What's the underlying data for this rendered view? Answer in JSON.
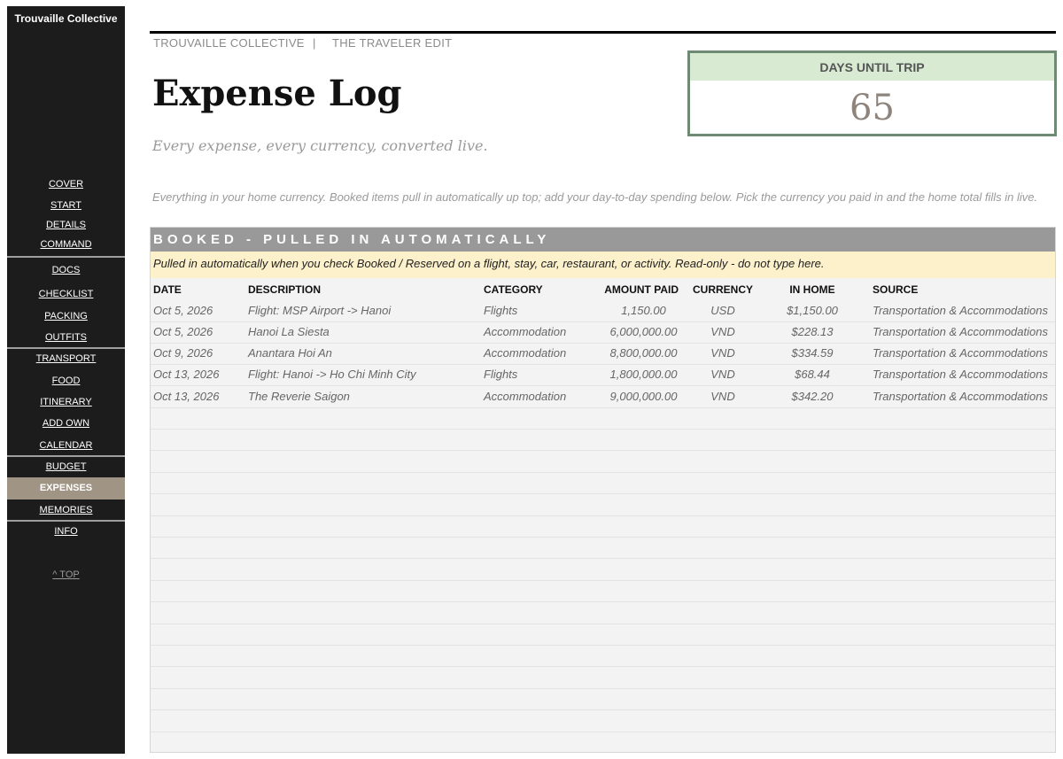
{
  "sidebar": {
    "brand": "Trouvaille Collective",
    "items": [
      {
        "label": "COVER"
      },
      {
        "label": "START"
      },
      {
        "label": "DETAILS"
      },
      {
        "label": "COMMAND"
      },
      {
        "label": "DOCS"
      },
      {
        "label": "CHECKLIST"
      },
      {
        "label": "PACKING"
      },
      {
        "label": "OUTFITS"
      },
      {
        "label": "TRANSPORT"
      },
      {
        "label": "FOOD"
      },
      {
        "label": "ITINERARY"
      },
      {
        "label": "ADD OWN"
      },
      {
        "label": "CALENDAR"
      },
      {
        "label": "BUDGET"
      },
      {
        "label": "EXPENSES"
      },
      {
        "label": "MEMORIES"
      },
      {
        "label": "INFO"
      }
    ],
    "active": "EXPENSES",
    "top_link": "^ TOP"
  },
  "header": {
    "brand": "TROUVAILLE COLLECTIVE",
    "separator": "|",
    "edition": "THE TRAVELER EDIT",
    "title": "Expense Log",
    "subtitle": "Every expense, every currency, converted live.",
    "intro": "Everything in your home currency. Booked items pull in automatically up top; add your day-to-day spending below. Pick the currency you paid in and the home total fills in live."
  },
  "countdown": {
    "label": "DAYS UNTIL TRIP",
    "value": "65"
  },
  "booked": {
    "title": "BOOKED  -  PULLED IN AUTOMATICALLY",
    "notice": "Pulled in automatically when you check Booked / Reserved on a flight, stay, car, restaurant, or activity. Read-only - do not type here.",
    "columns": {
      "date": "DATE",
      "description": "DESCRIPTION",
      "category": "CATEGORY",
      "amount": "AMOUNT PAID",
      "currency": "CURRENCY",
      "home": "IN HOME",
      "source": "SOURCE"
    },
    "rows": [
      {
        "date": "Oct 5, 2026",
        "description": "Flight: MSP Airport -> Hanoi",
        "category": "Flights",
        "amount": "1,150.00",
        "currency": "USD",
        "home": "$1,150.00",
        "source": "Transportation & Accommodations"
      },
      {
        "date": "Oct 5, 2026",
        "description": "Hanoi La Siesta",
        "category": "Accommodation",
        "amount": "6,000,000.00",
        "currency": "VND",
        "home": "$228.13",
        "source": "Transportation & Accommodations"
      },
      {
        "date": "Oct 9, 2026",
        "description": "Anantara Hoi An",
        "category": "Accommodation",
        "amount": "8,800,000.00",
        "currency": "VND",
        "home": "$334.59",
        "source": "Transportation & Accommodations"
      },
      {
        "date": "Oct 13, 2026",
        "description": "Flight: Hanoi -> Ho Chi Minh City",
        "category": "Flights",
        "amount": "1,800,000.00",
        "currency": "VND",
        "home": "$68.44",
        "source": "Transportation & Accommodations"
      },
      {
        "date": "Oct 13, 2026",
        "description": "The Reverie Saigon",
        "category": "Accommodation",
        "amount": "9,000,000.00",
        "currency": "VND",
        "home": "$342.20",
        "source": "Transportation & Accommodations"
      }
    ]
  },
  "colors": {
    "sidebar_bg": "#1c1c1c",
    "active_item": "#a09484",
    "countdown_border": "#6f8a72",
    "countdown_header": "#d9ead3",
    "section_bar": "#999999",
    "notice_bg": "#fdf1cc"
  }
}
